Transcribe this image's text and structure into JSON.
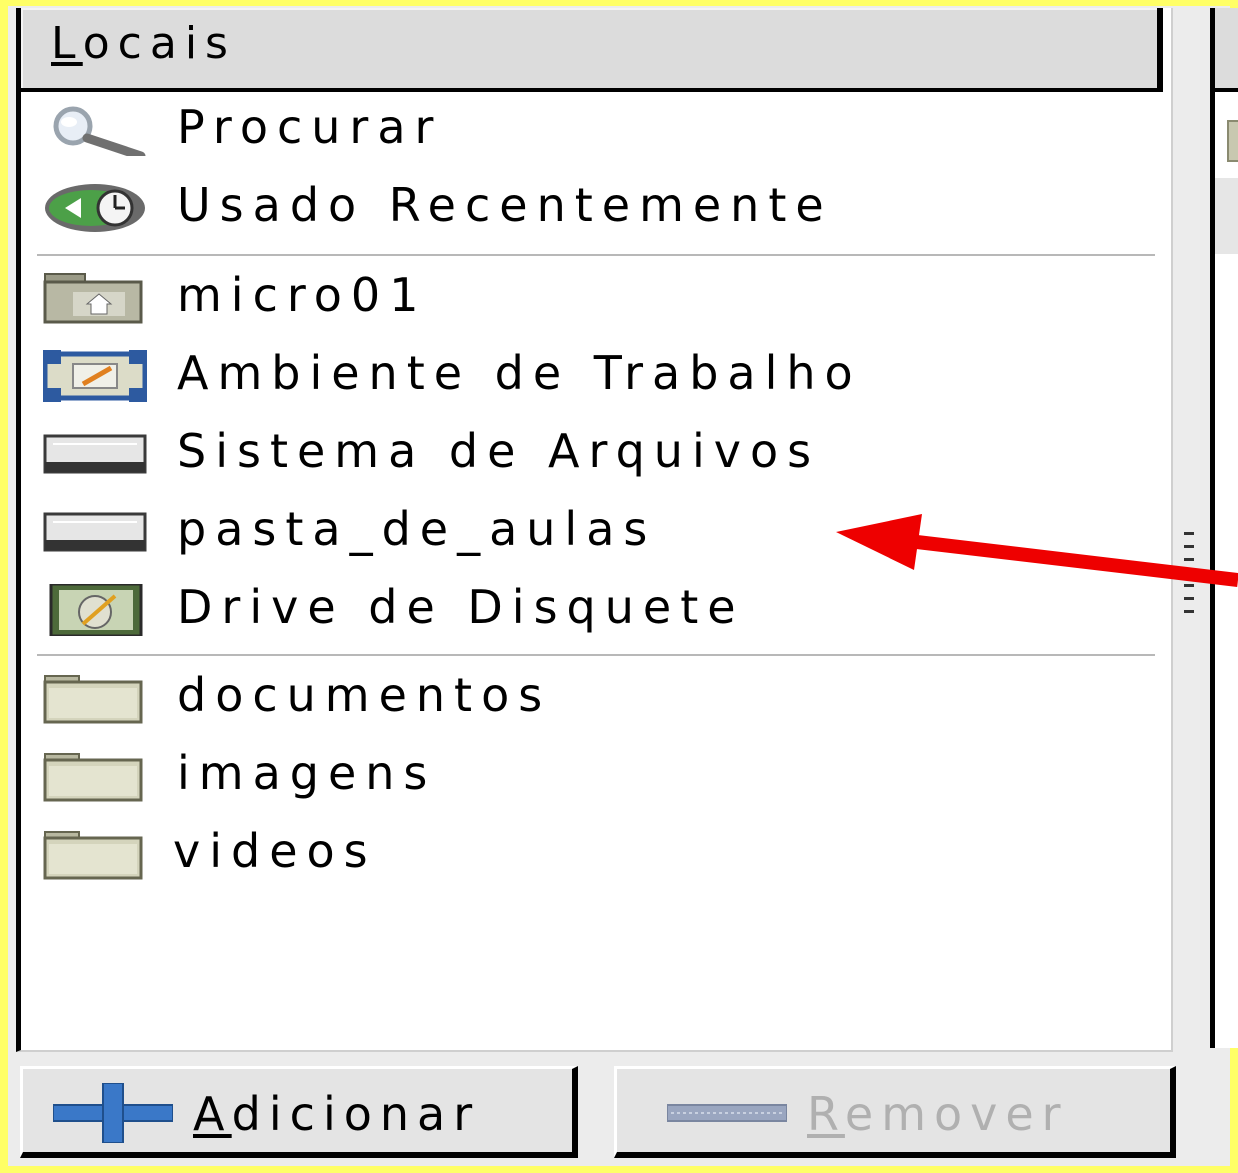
{
  "places": {
    "header": {
      "accel": "L",
      "rest": "ocais"
    },
    "items": [
      {
        "label": "Procurar",
        "icon": "search-icon"
      },
      {
        "label": "Usado Recentemente",
        "icon": "recent-clock-icon"
      },
      {
        "label": "micro01",
        "icon": "home-folder-icon"
      },
      {
        "label": "Ambiente de Trabalho",
        "icon": "desktop-icon"
      },
      {
        "label": "Sistema de Arquivos",
        "icon": "drive-icon"
      },
      {
        "label": "pasta_de_aulas",
        "icon": "drive-icon"
      },
      {
        "label": "Drive de Disquete",
        "icon": "floppy-icon"
      },
      {
        "label": "documentos",
        "icon": "folder-icon"
      },
      {
        "label": "imagens",
        "icon": "folder-icon"
      },
      {
        "label": "videos",
        "icon": "folder-icon"
      }
    ]
  },
  "buttons": {
    "add": {
      "accel": "A",
      "rest": "dicionar",
      "icon": "plus-icon"
    },
    "remove": {
      "accel": "R",
      "rest": "emover",
      "icon": "minus-icon",
      "enabled": false
    }
  },
  "colors": {
    "background": "#ffff66",
    "arrow": "#ee0000",
    "add_icon": "#3a78c8"
  }
}
